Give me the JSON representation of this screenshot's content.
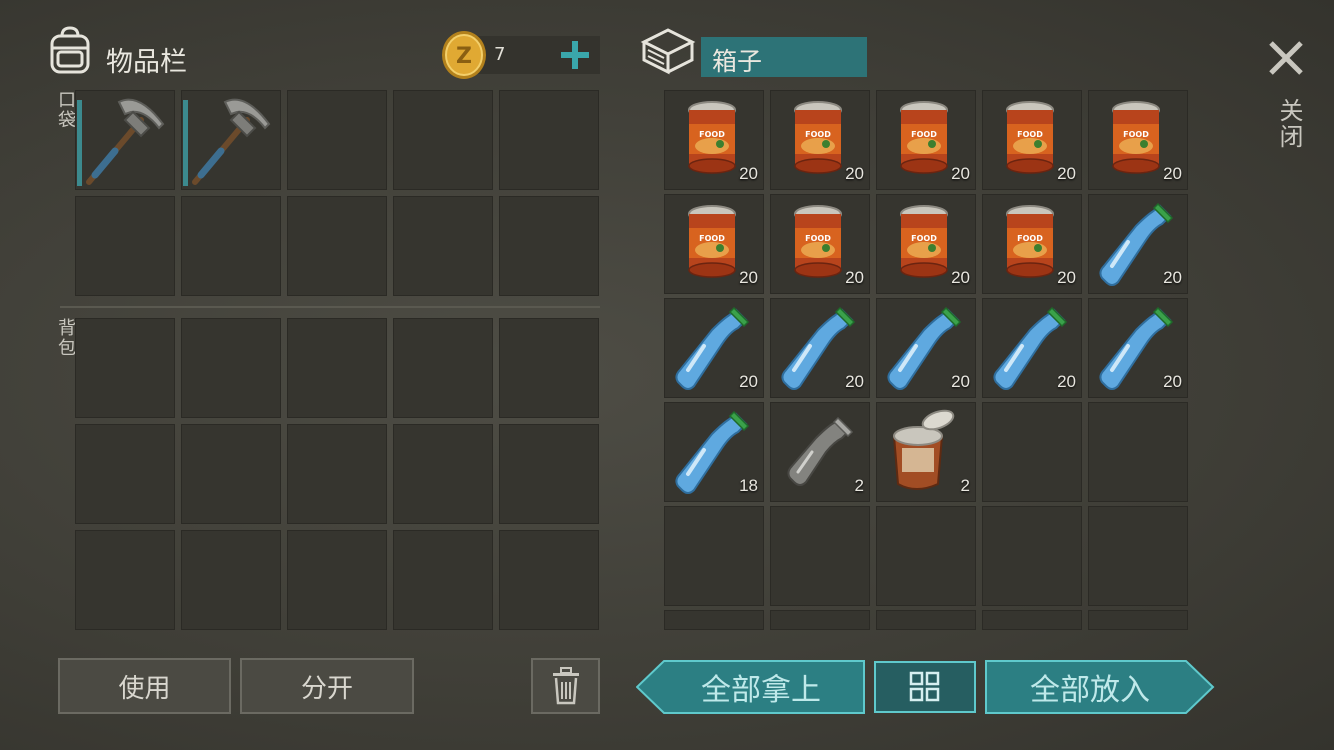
{
  "inventory": {
    "title": "物品栏",
    "coins": "7",
    "pocket_label": "口袋",
    "backpack_label": "背包",
    "pocket_items": [
      {
        "icon": "pickaxe-icon"
      },
      {
        "icon": "pickaxe-icon"
      }
    ]
  },
  "box": {
    "title": "箱子",
    "items": [
      {
        "icon": "canned-food-icon",
        "qty": "20"
      },
      {
        "icon": "canned-food-icon",
        "qty": "20"
      },
      {
        "icon": "canned-food-icon",
        "qty": "20"
      },
      {
        "icon": "canned-food-icon",
        "qty": "20"
      },
      {
        "icon": "canned-food-icon",
        "qty": "20"
      },
      {
        "icon": "canned-food-icon",
        "qty": "20"
      },
      {
        "icon": "canned-food-icon",
        "qty": "20"
      },
      {
        "icon": "canned-food-icon",
        "qty": "20"
      },
      {
        "icon": "canned-food-icon",
        "qty": "20"
      },
      {
        "icon": "water-bottle-icon",
        "qty": "20"
      },
      {
        "icon": "water-bottle-icon",
        "qty": "20"
      },
      {
        "icon": "water-bottle-icon",
        "qty": "20"
      },
      {
        "icon": "water-bottle-icon",
        "qty": "20"
      },
      {
        "icon": "water-bottle-icon",
        "qty": "20"
      },
      {
        "icon": "water-bottle-icon",
        "qty": "20"
      },
      {
        "icon": "water-bottle-icon",
        "qty": "18"
      },
      {
        "icon": "empty-bottle-icon",
        "qty": "2"
      },
      {
        "icon": "open-can-icon",
        "qty": "2"
      }
    ],
    "can_label": "FOOD"
  },
  "close_label": "关闭",
  "buttons": {
    "use": "使用",
    "split": "分开",
    "take_all": "全部拿上",
    "put_all": "全部放入"
  },
  "colors": {
    "teal": "#2f8f93",
    "slot": "#36352f"
  }
}
